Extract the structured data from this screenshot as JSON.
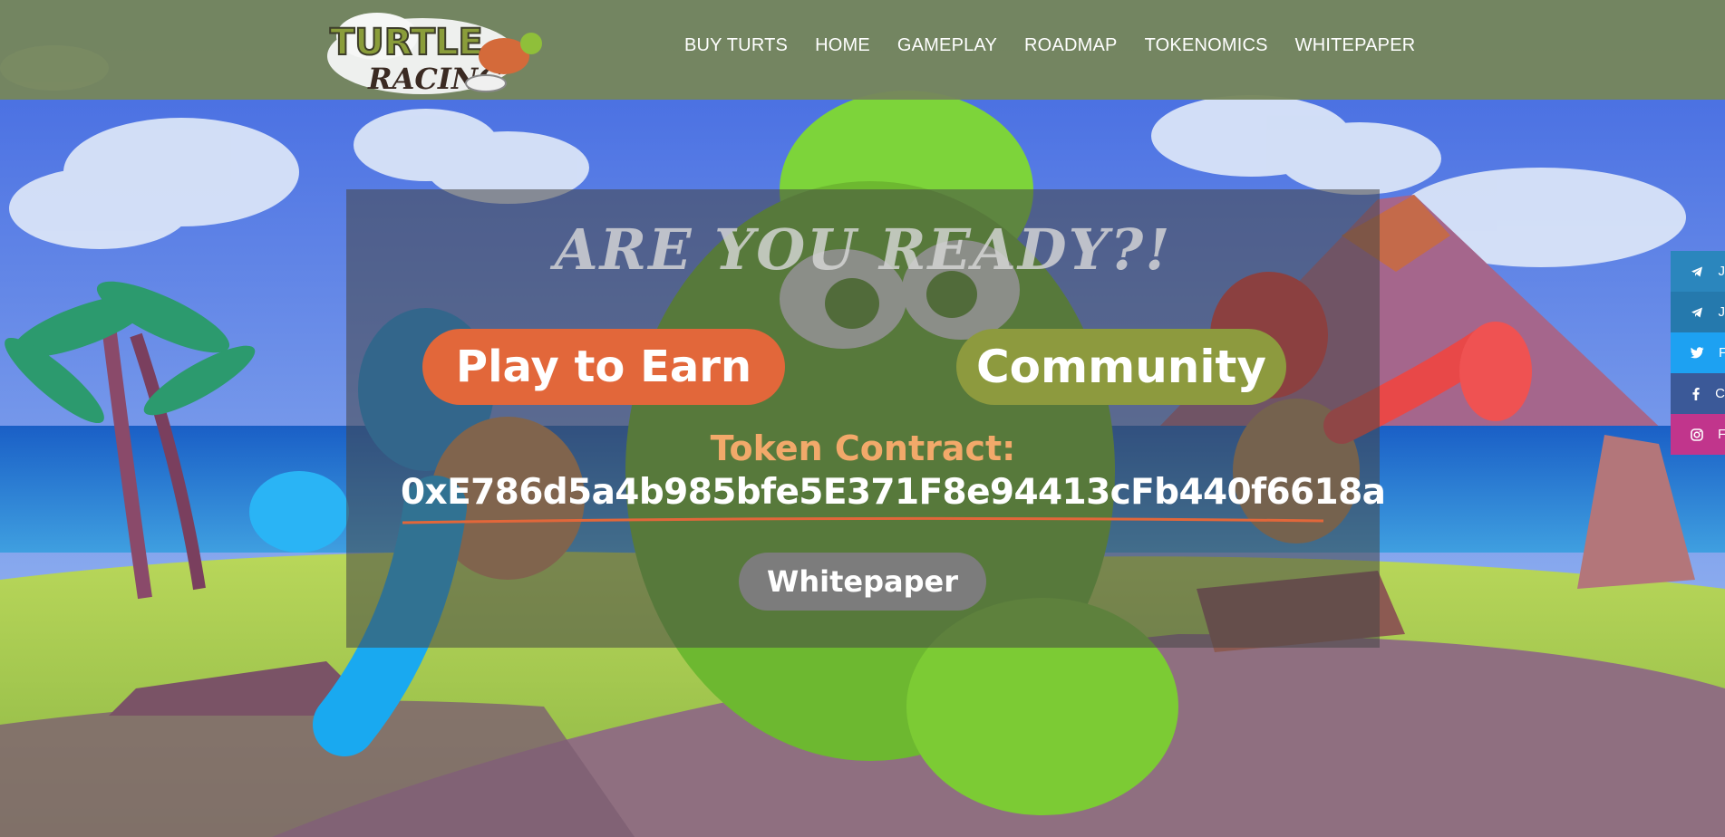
{
  "site": {
    "logo_text_line1": "TURTLE",
    "logo_text_line2": "RACING"
  },
  "nav": {
    "items": [
      {
        "label": "BUY TURTS"
      },
      {
        "label": "HOME"
      },
      {
        "label": "GAMEPLAY"
      },
      {
        "label": "ROADMAP"
      },
      {
        "label": "TOKENOMICS"
      },
      {
        "label": "WHITEPAPER"
      }
    ]
  },
  "hero": {
    "headline": "ARE YOU READY?!",
    "play_button": "Play to Earn",
    "community_button": "Community",
    "token_label": "Token Contract:",
    "token_address": "0xE786d5a4b985bfe5E371F8e94413cFb440f6618a",
    "whitepaper_button": "Whitepaper"
  },
  "social": {
    "items": [
      {
        "icon": "telegram-icon",
        "label": "J",
        "color": "#2b86bd"
      },
      {
        "icon": "telegram-icon",
        "label": "J",
        "color": "#2579ad"
      },
      {
        "icon": "twitter-icon",
        "label": "F",
        "color": "#1da1f2"
      },
      {
        "icon": "facebook-icon",
        "label": "C",
        "color": "#3b5998"
      },
      {
        "icon": "instagram-icon",
        "label": "F",
        "color": "#c1358c"
      }
    ]
  },
  "colors": {
    "header_bg": "#76865c",
    "play_button": "#e2673a",
    "community_button": "#8d9a3e",
    "token_label": "#f2a96a",
    "whitepaper_button": "#7c7c7c"
  }
}
